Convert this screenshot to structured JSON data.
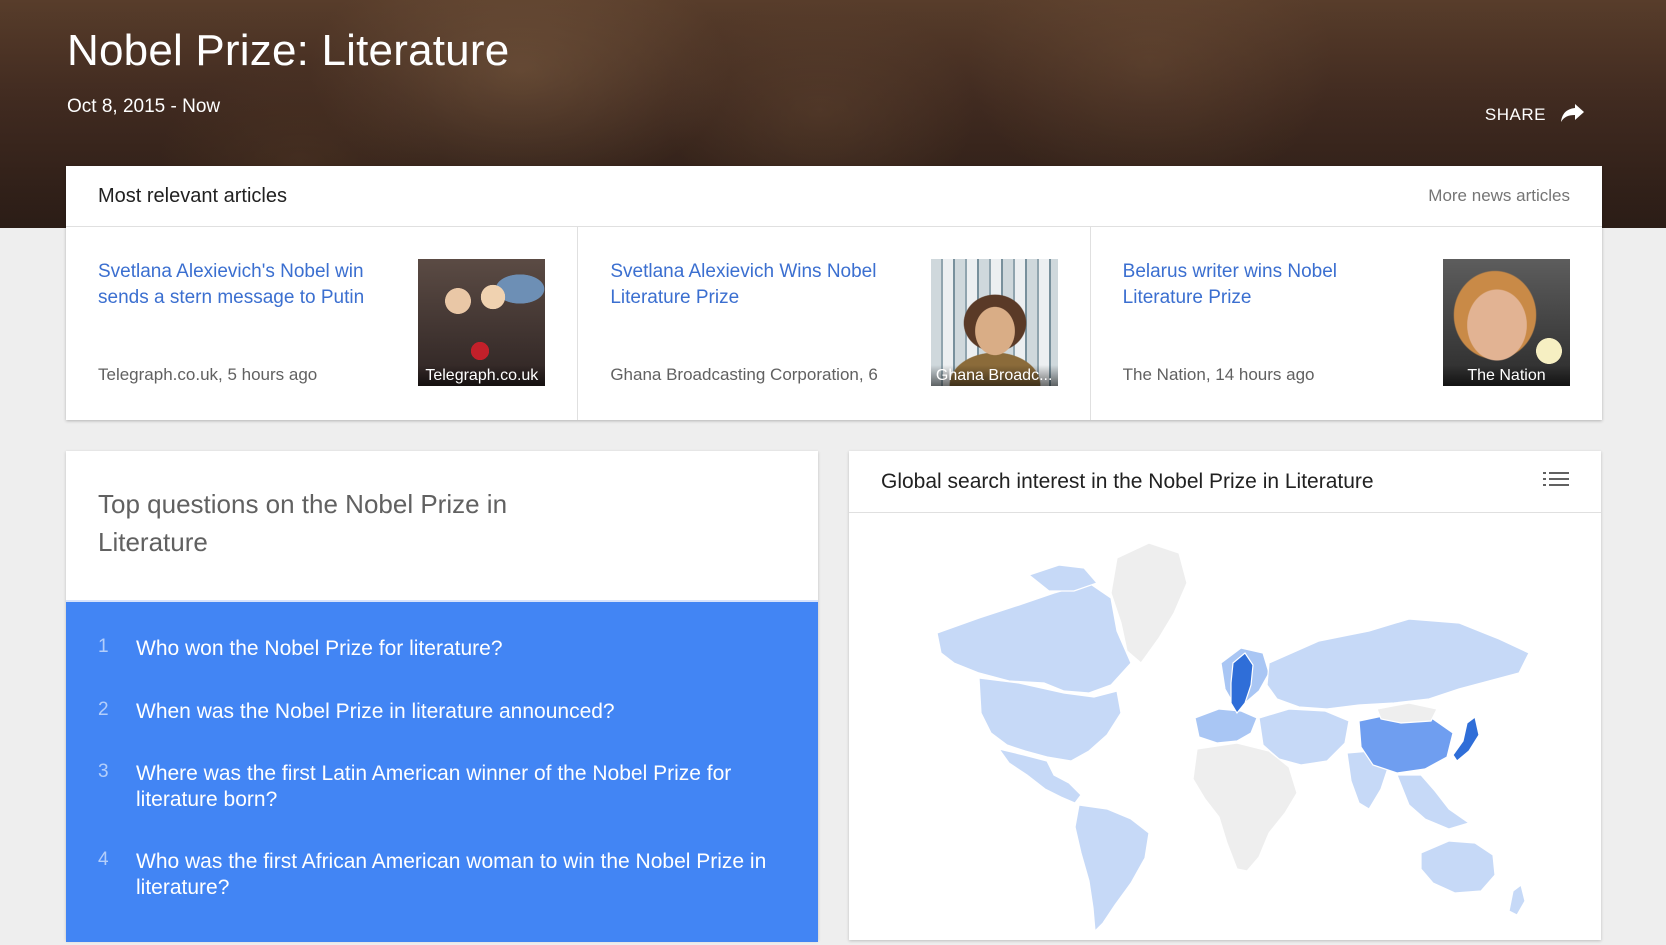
{
  "header": {
    "title": "Nobel Prize: Literature",
    "date_range": "Oct 8, 2015 - Now",
    "share_label": "SHARE"
  },
  "articles": {
    "title": "Most relevant articles",
    "more_label": "More news articles",
    "items": [
      {
        "headline": "Svetlana Alexievich's Nobel win sends a stern message to Putin",
        "source": "Telegraph.co.uk, 5 hours ago",
        "image_caption": "Telegraph.co.uk"
      },
      {
        "headline": "Svetlana Alexievich Wins Nobel Literature Prize",
        "source": "Ghana Broadcasting Corporation, 6",
        "image_caption": "Ghana Broadc..."
      },
      {
        "headline": "Belarus writer wins Nobel Literature Prize",
        "source": "The Nation, 14 hours ago",
        "image_caption": "The Nation"
      }
    ]
  },
  "questions": {
    "title": "Top questions on the Nobel Prize in Literature",
    "items": [
      {
        "number": "1",
        "text": "Who won the Nobel Prize for literature?"
      },
      {
        "number": "2",
        "text": "When was the Nobel Prize in literature announced?"
      },
      {
        "number": "3",
        "text": "Where was the first Latin American winner of the Nobel Prize for literature born?"
      },
      {
        "number": "4",
        "text": "Who was the first African American woman to win the Nobel Prize in literature?"
      }
    ]
  },
  "map": {
    "title": "Global search interest in the Nobel Prize in Literature",
    "colors": {
      "no_data": "#eeeeee",
      "low": "#c6d9f7",
      "mid": "#a9c6f4",
      "high": "#6f9ef0",
      "highest": "#2f6ed8"
    }
  }
}
